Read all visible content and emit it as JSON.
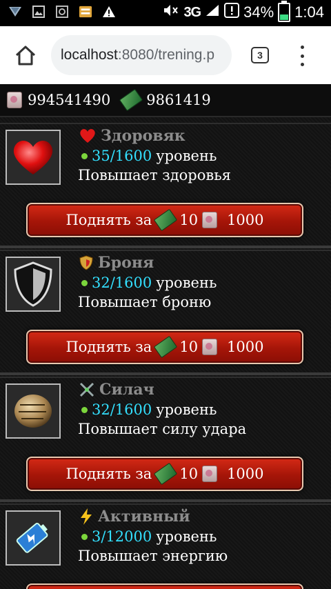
{
  "statusbar": {
    "network": "3G",
    "signal_sup": "1",
    "notif_sup": "2",
    "battery": "34%",
    "time": "1:04",
    "battery_level": 0.34
  },
  "browser": {
    "url_host": "localhost",
    "url_path": ":8080/trening.p",
    "tab_count": "3"
  },
  "currency": {
    "scrolls": "994541490",
    "money": "9861419"
  },
  "skills": [
    {
      "name": "Здоровяк",
      "level": "35/1600",
      "level_word": "уровень",
      "desc": "Повышает здоровья",
      "icon": "heart-icon"
    },
    {
      "name": "Броня",
      "level": "32/1600",
      "level_word": "уровень",
      "desc": "Повышает броню",
      "icon": "shield-icon"
    },
    {
      "name": "Силач",
      "level": "32/1600",
      "level_word": "уровень",
      "desc": "Повышает силу удара",
      "icon": "fist-icon"
    },
    {
      "name": "Активный",
      "level": "3/12000",
      "level_word": "уровень",
      "desc": "Повышает энергию",
      "icon": "battery-icon"
    }
  ],
  "upgrade": {
    "label": "Поднять за",
    "money_cost": "10",
    "scroll_cost": "1000"
  }
}
